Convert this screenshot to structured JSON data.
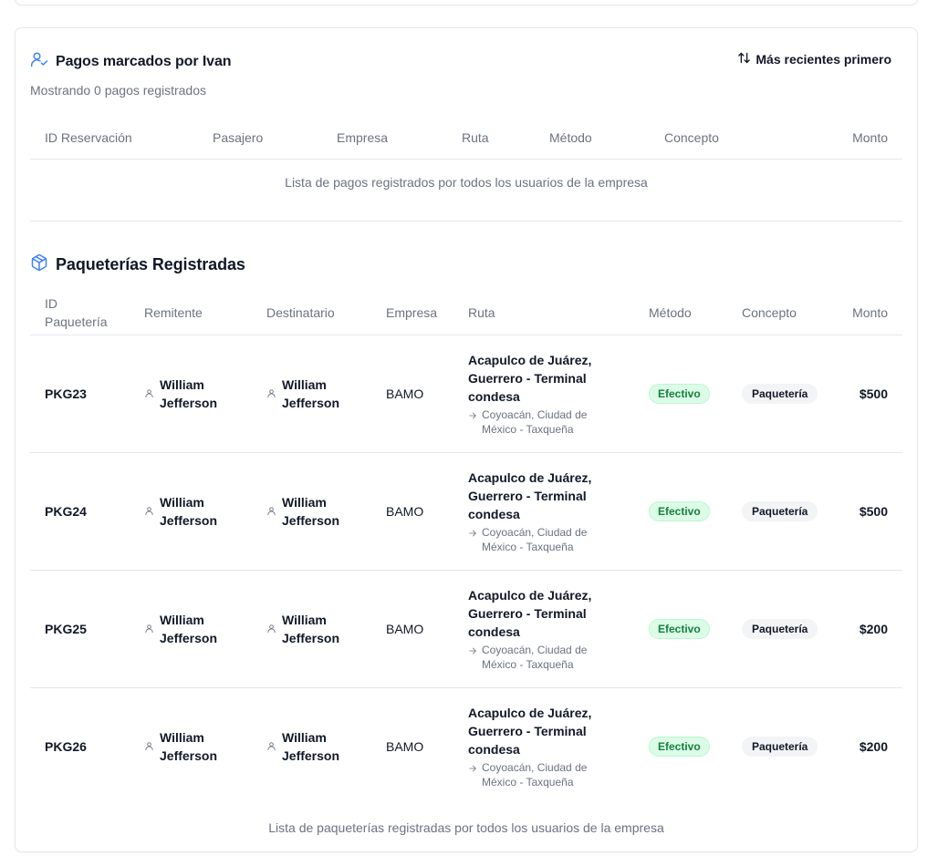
{
  "pagos": {
    "title": "Pagos marcados por Ivan",
    "sort_label": "Más recientes primero",
    "subtitle": "Mostrando 0 pagos registrados",
    "columns": [
      "ID Reservación",
      "Pasajero",
      "Empresa",
      "Ruta",
      "Método",
      "Concepto",
      "Monto"
    ],
    "caption": "Lista de pagos registrados por todos los usuarios de la empresa"
  },
  "paqueterias": {
    "title": "Paqueterías Registradas",
    "columns": [
      "ID Paquetería",
      "Remitente",
      "Destinatario",
      "Empresa",
      "Ruta",
      "Método",
      "Concepto",
      "Monto"
    ],
    "rows": [
      {
        "id": "PKG23",
        "remitente": "William Jefferson",
        "destinatario": "William Jefferson",
        "empresa": "BAMO",
        "ruta_origen": "Acapulco de Juárez, Guerrero - Terminal condesa",
        "ruta_destino": "Coyoacán, Ciudad de México - Taxqueña",
        "metodo": "Efectivo",
        "concepto": "Paquetería",
        "monto": "$500"
      },
      {
        "id": "PKG24",
        "remitente": "William Jefferson",
        "destinatario": "William Jefferson",
        "empresa": "BAMO",
        "ruta_origen": "Acapulco de Juárez, Guerrero - Terminal condesa",
        "ruta_destino": "Coyoacán, Ciudad de México - Taxqueña",
        "metodo": "Efectivo",
        "concepto": "Paquetería",
        "monto": "$500"
      },
      {
        "id": "PKG25",
        "remitente": "William Jefferson",
        "destinatario": "William Jefferson",
        "empresa": "BAMO",
        "ruta_origen": "Acapulco de Juárez, Guerrero - Terminal condesa",
        "ruta_destino": "Coyoacán, Ciudad de México - Taxqueña",
        "metodo": "Efectivo",
        "concepto": "Paquetería",
        "monto": "$200"
      },
      {
        "id": "PKG26",
        "remitente": "William Jefferson",
        "destinatario": "William Jefferson",
        "empresa": "BAMO",
        "ruta_origen": "Acapulco de Juárez, Guerrero - Terminal condesa",
        "ruta_destino": "Coyoacán, Ciudad de México - Taxqueña",
        "metodo": "Efectivo",
        "concepto": "Paquetería",
        "monto": "$200"
      }
    ],
    "caption": "Lista de paqueterías registradas por todos los usuarios de la empresa"
  },
  "icons": {
    "pagos": "user-check-icon",
    "sort": "sort-arrows-icon",
    "paqueterias": "package-icon",
    "person": "user-icon",
    "arrow": "arrow-right-icon"
  },
  "colors": {
    "accent": "#3b82f6",
    "badge_green_bg": "#dcfce7",
    "badge_green_text": "#15803d",
    "badge_gray_bg": "#f3f4f6",
    "muted_text": "#6b7280",
    "border": "#e5e7eb"
  }
}
